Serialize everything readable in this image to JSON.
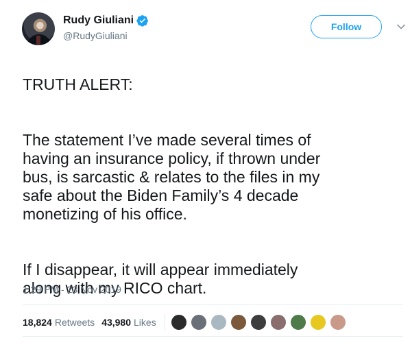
{
  "user": {
    "name": "Rudy Giuliani",
    "handle": "@RudyGiuliani",
    "verified": true,
    "verified_icon": "verified-badge-icon"
  },
  "header": {
    "follow_label": "Follow",
    "caret_icon": "chevron-down-icon"
  },
  "tweet": {
    "paragraphs": [
      "TRUTH ALERT:",
      "The statement I’ve made several times of\nhaving an insurance policy, if thrown under\nbus, is sarcastic & relates to the files in my\nsafe about the Biden Family’s 4 decade\nmonetizing of his office.",
      "If I disappear, it will appear immediately\nalong with my RICO chart."
    ],
    "timestamp": "1:29 PM - 23 Nov 2019"
  },
  "stats": {
    "retweets_count": "18,824",
    "retweets_label": "Retweets",
    "likes_count": "43,980",
    "likes_label": "Likes"
  },
  "colors": {
    "accent": "#1da1f2",
    "text": "#14171a",
    "secondary": "#657786",
    "divider": "#e6ecf0"
  },
  "liker_avatars": [
    {
      "name": "liker-avatar-1",
      "color": "#2b2b2b"
    },
    {
      "name": "liker-avatar-2",
      "color": "#6b6f78"
    },
    {
      "name": "liker-avatar-3",
      "color": "#aab8c2"
    },
    {
      "name": "liker-avatar-4",
      "color": "#7a5a3a"
    },
    {
      "name": "liker-avatar-5",
      "color": "#3d3d3d"
    },
    {
      "name": "liker-avatar-6",
      "color": "#8a6e6e"
    },
    {
      "name": "liker-avatar-7",
      "color": "#4f7a4a"
    },
    {
      "name": "liker-avatar-8",
      "color": "#e7c821"
    },
    {
      "name": "liker-avatar-9",
      "color": "#c99a8a"
    }
  ]
}
